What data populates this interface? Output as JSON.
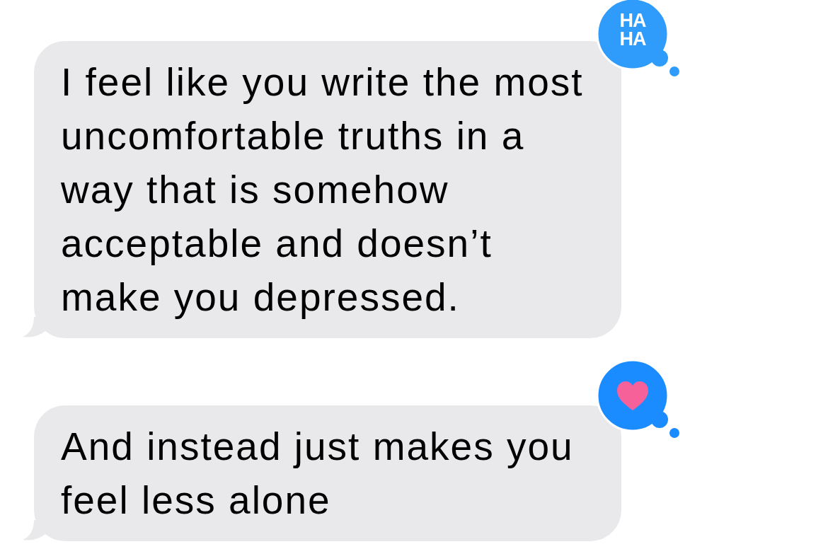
{
  "messages": [
    {
      "text": "I feel like you write the most uncomfortable truths in a way that is somehow acceptable and doesn’t make you depressed.",
      "tapback": {
        "kind": "haha",
        "lines": [
          "HA",
          "HA"
        ]
      }
    },
    {
      "text": "And instead just makes you feel less alone",
      "tapback": {
        "kind": "heart"
      }
    }
  ]
}
